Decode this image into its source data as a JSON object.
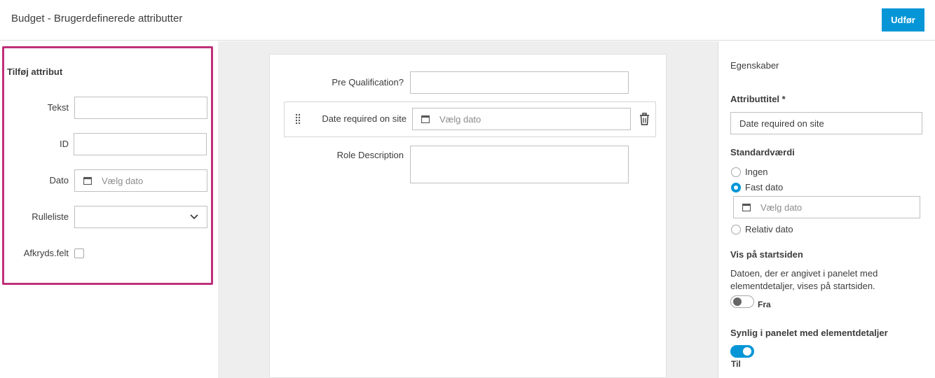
{
  "header": {
    "title": "Budget - Brugerdefinerede attributter",
    "submit_label": "Udfør"
  },
  "left": {
    "title": "Tilføj attribut",
    "fields": {
      "text_label": "Tekst",
      "id_label": "ID",
      "date_label": "Dato",
      "date_placeholder": "Vælg dato",
      "dropdown_label": "Rulleliste",
      "checkbox_label": "Afkryds.felt"
    }
  },
  "form": {
    "pre_qualification_label": "Pre Qualification?",
    "date_required_label": "Date required on site",
    "date_placeholder": "Vælg dato",
    "role_description_label": "Role Description"
  },
  "properties": {
    "title": "Egenskaber",
    "attribute_title_label": "Attributtitel *",
    "attribute_title_value": "Date required on site",
    "default_value_label": "Standardværdi",
    "options": [
      "Ingen",
      "Fast dato",
      "Relativ dato"
    ],
    "selected_option": "Fast dato",
    "date_placeholder": "Vælg dato",
    "show_on_start_label": "Vis på startsiden",
    "show_on_start_desc_line1": "Datoen, der er angivet i panelet med",
    "show_on_start_desc_line2": "elementdetaljer, vises på startsiden.",
    "show_on_start_state": "Fra",
    "visible_in_details_label": "Synlig i panelet med elementdetaljer",
    "visible_in_details_state": "Til"
  },
  "colors": {
    "accent": "#0696d7",
    "highlight": "#c0307a"
  },
  "icons": {
    "calendar": "calendar-icon",
    "trash": "trash-icon",
    "drag": "drag-handle-icon",
    "chevron": "chevron-down-icon"
  }
}
